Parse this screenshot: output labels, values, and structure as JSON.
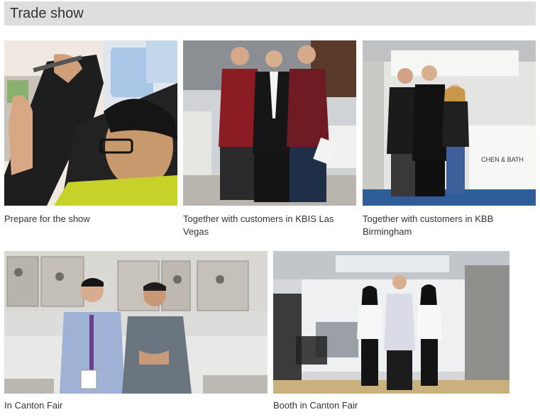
{
  "section": {
    "title": "Trade show"
  },
  "gallery": [
    {
      "caption": "Prepare for the show",
      "photo_name": "prepare-photo"
    },
    {
      "caption": "Together with customers in KBIS Las Vegas",
      "photo_name": "kbis-photo"
    },
    {
      "caption": "Together with customers in KBB Birmingham",
      "photo_name": "kbb-photo",
      "sign_text": "CHEN & BATH"
    },
    {
      "caption": "In Canton Fair",
      "photo_name": "canton-photo"
    },
    {
      "caption": "Booth in Canton Fair",
      "photo_name": "booth-photo"
    }
  ]
}
